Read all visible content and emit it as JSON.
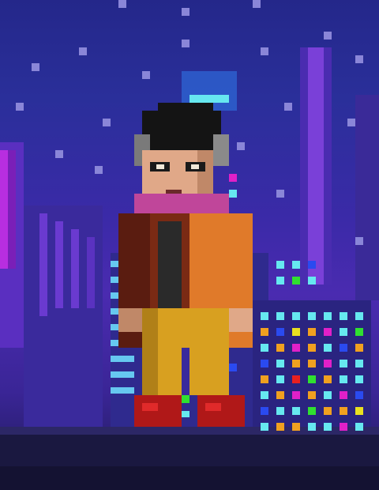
{
  "scene": {
    "palette": {
      "sky_top": "#24278a",
      "sky_mid": "#4a2bb0",
      "ground": "#1a1840",
      "neon_magenta": "#e020c8",
      "neon_cyan": "#66e8f0"
    },
    "character": {
      "hair_color": "#141414",
      "skin_color": "#e0a888",
      "jacket_color": "#e07a2a",
      "scarf_color": "#c0469a",
      "pants_color": "#d8a020",
      "boots_color": "#b01818"
    }
  }
}
